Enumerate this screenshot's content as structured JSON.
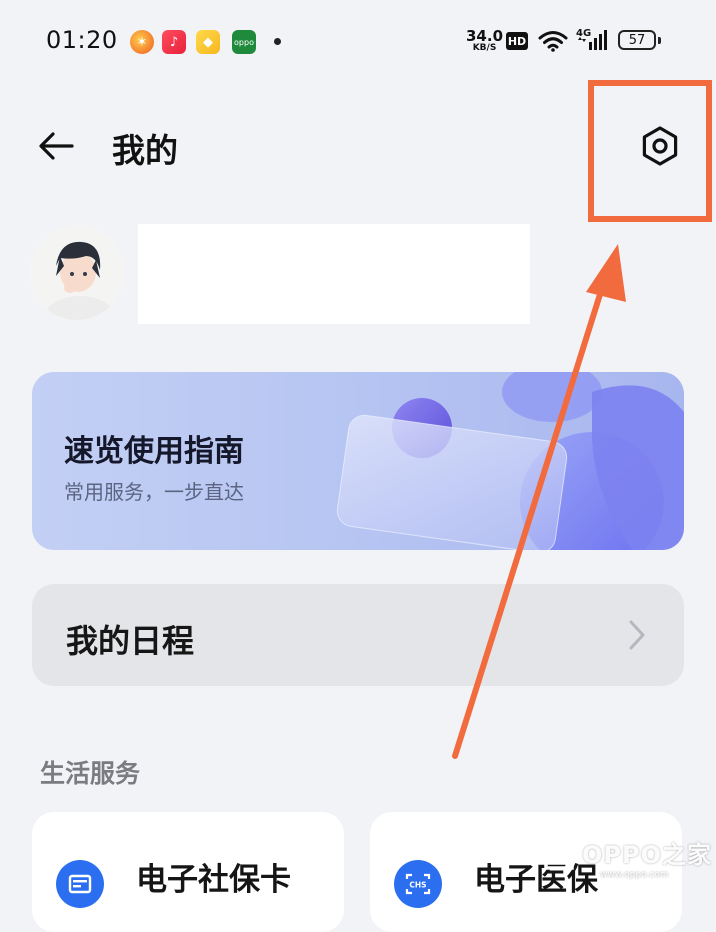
{
  "status_bar": {
    "time": "01:20",
    "net_speed_value": "34.0",
    "net_speed_unit": "KB/S",
    "hd_badge": "HD",
    "network": "4G",
    "battery": "57",
    "app_icons": [
      "weibo-icon",
      "music-icon",
      "wallet-icon",
      "oppo-app-icon"
    ]
  },
  "header": {
    "title": "我的",
    "back_icon": "back-arrow-icon",
    "settings_icon": "settings-hexagon-icon"
  },
  "guide_card": {
    "title": "速览使用指南",
    "subtitle": "常用服务，一步直达"
  },
  "schedule": {
    "label": "我的日程"
  },
  "section": {
    "title": "生活服务"
  },
  "services": [
    {
      "label": "电子社保卡",
      "icon": "social-security-card-icon"
    },
    {
      "label": "电子医保",
      "icon": "medical-insurance-icon"
    }
  ],
  "watermark": {
    "text": "OPPO之家",
    "url": "www.oppo.com"
  },
  "colors": {
    "annotation": "#f26b3f",
    "background": "#f2f3f6",
    "service_icon": "#2b6ff0"
  }
}
